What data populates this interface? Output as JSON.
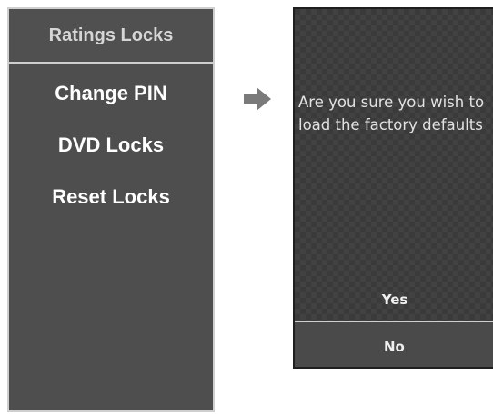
{
  "ratings_menu": {
    "title": "Ratings Locks",
    "items": [
      {
        "label": "Change PIN"
      },
      {
        "label": "DVD Locks"
      },
      {
        "label": "Reset Locks"
      }
    ]
  },
  "confirm_dialog": {
    "message_line1": "Are you sure you wish to",
    "message_line2": "load the factory defaults",
    "yes_label": "Yes",
    "no_label": "No"
  },
  "colors": {
    "panel_bg": "#4e4e4e",
    "panel_border": "#cfcfcf",
    "dialog_bg": "#3a3a3a",
    "text": "#ffffff"
  },
  "icons": {
    "flow_arrow": "right-arrow-icon"
  }
}
